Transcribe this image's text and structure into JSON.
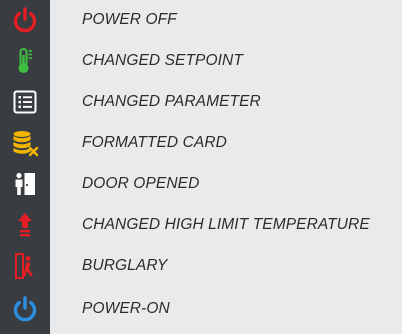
{
  "legend": {
    "items": [
      {
        "icon": "power-off-icon",
        "icon_color": "#e31e24",
        "label": "POWER OFF"
      },
      {
        "icon": "thermometer-icon",
        "icon_color": "#3fbf3f",
        "label": "CHANGED SETPOINT"
      },
      {
        "icon": "list-icon",
        "icon_color": "#ffffff",
        "label": "CHANGED PARAMETER"
      },
      {
        "icon": "formatted-card-icon",
        "icon_color": "#f2b600",
        "label": "FORMATTED CARD"
      },
      {
        "icon": "door-opened-icon",
        "icon_color": "#ffffff",
        "label": "DOOR OPENED"
      },
      {
        "icon": "high-limit-temperature-icon",
        "icon_color": "#e31e24",
        "label": "CHANGED HIGH LIMIT TEMPERATURE"
      },
      {
        "icon": "burglary-icon",
        "icon_color": "#e31e24",
        "label": "BURGLARY"
      },
      {
        "icon": "power-on-icon",
        "icon_color": "#2c8fe0",
        "label": "POWER-ON"
      }
    ]
  }
}
